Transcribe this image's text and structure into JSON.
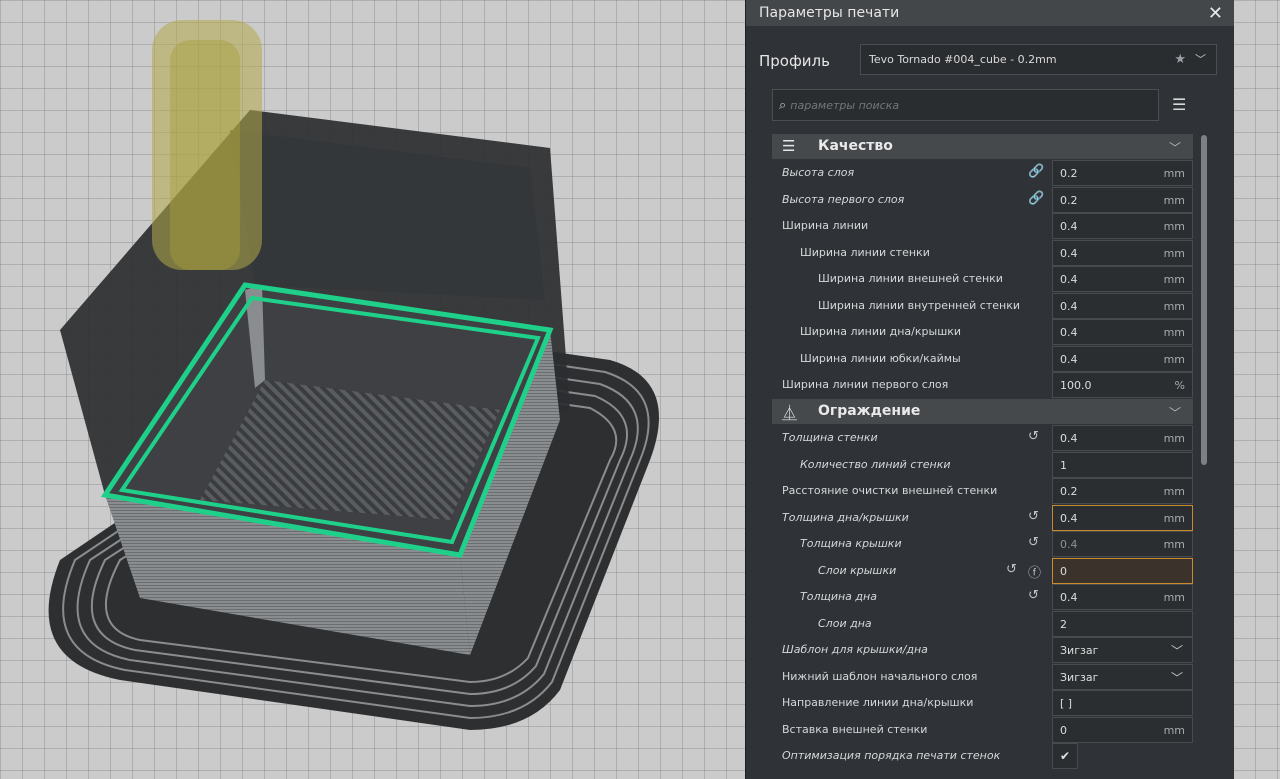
{
  "panel": {
    "title": "Параметры печати",
    "close_icon": "close-icon",
    "profile_label": "Профиль",
    "profile_value": "Tevo Tornado #004_cube - 0.2mm",
    "search_placeholder": "параметры поиска"
  },
  "sections": {
    "quality": {
      "title": "Качество",
      "icon": "quality-icon"
    },
    "shell": {
      "title": "Ограждение",
      "icon": "shell-icon"
    }
  },
  "quality_rows": [
    {
      "label": "Высота слоя",
      "value": "0.2",
      "unit": "mm"
    },
    {
      "label": "Высота первого слоя",
      "value": "0.2",
      "unit": "mm"
    },
    {
      "label": "Ширина линии",
      "value": "0.4",
      "unit": "mm"
    },
    {
      "label": "Ширина линии стенки",
      "value": "0.4",
      "unit": "mm"
    },
    {
      "label": "Ширина линии внешней стенки",
      "value": "0.4",
      "unit": "mm"
    },
    {
      "label": "Ширина линии внутренней стенки",
      "value": "0.4",
      "unit": "mm"
    },
    {
      "label": "Ширина линии дна/крышки",
      "value": "0.4",
      "unit": "mm"
    },
    {
      "label": "Ширина линии юбки/каймы",
      "value": "0.4",
      "unit": "mm"
    },
    {
      "label": "Ширина линии первого слоя",
      "value": "100.0",
      "unit": "%"
    }
  ],
  "shell_rows": [
    {
      "label": "Толщина стенки",
      "value": "0.4",
      "unit": "mm"
    },
    {
      "label": "Количество линий стенки",
      "value": "1",
      "unit": ""
    },
    {
      "label": "Расстояние очистки внешней стенки",
      "value": "0.2",
      "unit": "mm"
    },
    {
      "label": "Толщина дна/крышки",
      "value": "0.4",
      "unit": "mm"
    },
    {
      "label": "Толщина крышки",
      "value": "0.4",
      "unit": "mm"
    },
    {
      "label": "Слои крышки",
      "value": "0",
      "unit": ""
    },
    {
      "label": "Толщина дна",
      "value": "0.4",
      "unit": "mm"
    },
    {
      "label": "Слои дна",
      "value": "2",
      "unit": ""
    },
    {
      "label": "Шаблон для крышки/дна",
      "value": "Зигзаг",
      "unit": ""
    },
    {
      "label": "Нижний шаблон начального слоя",
      "value": "Зигзаг",
      "unit": ""
    },
    {
      "label": "Направление линии дна/крышки",
      "value": "[ ]",
      "unit": ""
    },
    {
      "label": "Вставка внешней стенки",
      "value": "0",
      "unit": "mm"
    },
    {
      "label": "Оптимизация порядка печати стенок",
      "value": "",
      "unit": ""
    }
  ]
}
